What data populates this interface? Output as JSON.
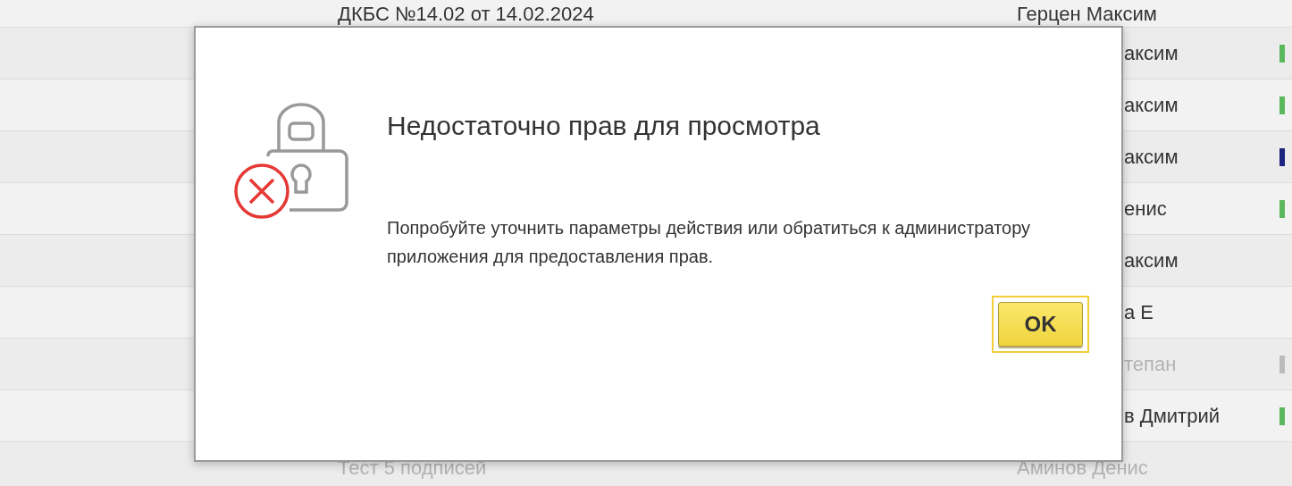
{
  "table": {
    "rows": [
      {
        "kind": "full",
        "document": "ДКБС №14.02 от 14.02.2024",
        "author": "Герцен Максим",
        "muted": false
      },
      {
        "kind": "clipped",
        "author": "аксим",
        "muted": false,
        "color": "#5cb85c"
      },
      {
        "kind": "clipped",
        "author": "аксим",
        "muted": false,
        "color": "#5cb85c"
      },
      {
        "kind": "clipped",
        "author": "аксим",
        "muted": false,
        "color": "#1a237e"
      },
      {
        "kind": "clipped",
        "author": "енис",
        "muted": false,
        "color": "#5cb85c"
      },
      {
        "kind": "clipped",
        "author": "аксим",
        "muted": false
      },
      {
        "kind": "clipped",
        "author": "а Е",
        "muted": false
      },
      {
        "kind": "clipped",
        "author": "тепан",
        "muted": true,
        "color": "#bbbbbb"
      },
      {
        "kind": "clipped",
        "author": "в Дмитрий",
        "muted": false,
        "color": "#5cb85c"
      },
      {
        "kind": "full",
        "document": "Тест 5 подписей",
        "author": "Аминов Денис",
        "muted": true
      }
    ]
  },
  "dialog": {
    "title": "Недостаточно прав для просмотра",
    "message": "Попробуйте уточнить параметры действия или обратиться к администратору приложения для предоставления прав.",
    "button": {
      "label": "OK",
      "focused": true
    }
  }
}
